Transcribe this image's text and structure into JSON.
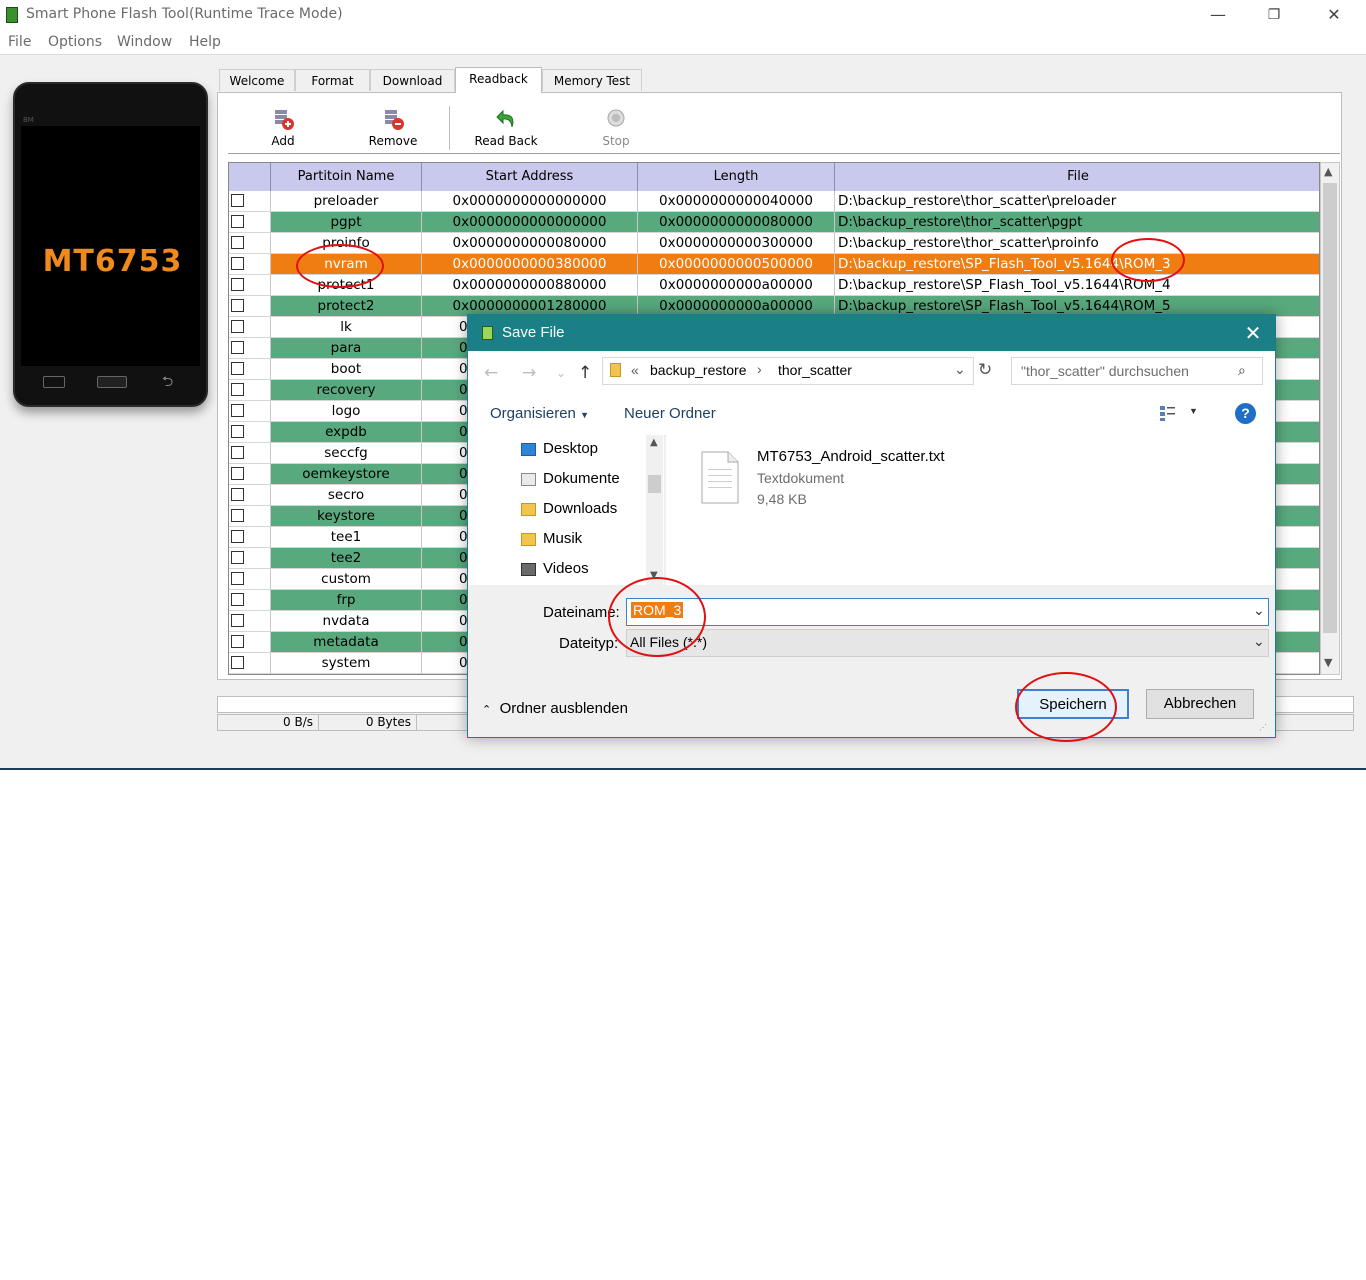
{
  "window": {
    "title": "Smart Phone Flash Tool(Runtime Trace Mode)",
    "controls": {
      "minimize": "—",
      "maximize": "❐",
      "close": "✕"
    }
  },
  "menu": [
    "File",
    "Options",
    "Window",
    "Help"
  ],
  "phone": {
    "model": "MT6753",
    "brand": "BM"
  },
  "tabs": [
    "Welcome",
    "Format",
    "Download",
    "Readback",
    "Memory Test"
  ],
  "active_tab": "Readback",
  "toolbar": {
    "add": "Add",
    "remove": "Remove",
    "read_back": "Read Back",
    "stop": "Stop"
  },
  "table": {
    "headers": [
      "Partitoin Name",
      "Start Address",
      "Length",
      "File"
    ],
    "rows": [
      {
        "name": "preloader",
        "start": "0x0000000000000000",
        "length": "0x0000000000040000",
        "file": "D:\\backup_restore\\thor_scatter\\preloader",
        "style": "white"
      },
      {
        "name": "pgpt",
        "start": "0x0000000000000000",
        "length": "0x0000000000080000",
        "file": "D:\\backup_restore\\thor_scatter\\pgpt",
        "style": "green"
      },
      {
        "name": "proinfo",
        "start": "0x0000000000080000",
        "length": "0x0000000000300000",
        "file": "D:\\backup_restore\\thor_scatter\\proinfo",
        "style": "white"
      },
      {
        "name": "nvram",
        "start": "0x0000000000380000",
        "length": "0x0000000000500000",
        "file": "D:\\backup_restore\\SP_Flash_Tool_v5.1644\\ROM_3",
        "style": "sel"
      },
      {
        "name": "protect1",
        "start": "0x0000000000880000",
        "length": "0x0000000000a00000",
        "file": "D:\\backup_restore\\SP_Flash_Tool_v5.1644\\ROM_4",
        "style": "white"
      },
      {
        "name": "protect2",
        "start": "0x0000000001280000",
        "length": "0x0000000000a00000",
        "file": "D:\\backup_restore\\SP_Flash_Tool_v5.1644\\ROM_5",
        "style": "green"
      },
      {
        "name": "lk",
        "start": "0",
        "length": "",
        "file": "",
        "style": "white"
      },
      {
        "name": "para",
        "start": "0",
        "length": "",
        "file": "",
        "style": "green"
      },
      {
        "name": "boot",
        "start": "0:",
        "length": "",
        "file": "",
        "style": "white"
      },
      {
        "name": "recovery",
        "start": "0:",
        "length": "",
        "file": "",
        "style": "green"
      },
      {
        "name": "logo",
        "start": "0:",
        "length": "",
        "file": "",
        "style": "white"
      },
      {
        "name": "expdb",
        "start": "0",
        "length": "",
        "file": "",
        "style": "green"
      },
      {
        "name": "seccfg",
        "start": "0",
        "length": "",
        "file": "",
        "style": "white"
      },
      {
        "name": "oemkeystore",
        "start": "0",
        "length": "",
        "file": "",
        "style": "green"
      },
      {
        "name": "secro",
        "start": "0:",
        "length": "",
        "file": "",
        "style": "white"
      },
      {
        "name": "keystore",
        "start": "0",
        "length": "",
        "file": "",
        "style": "green"
      },
      {
        "name": "tee1",
        "start": "0",
        "length": "",
        "file": "",
        "style": "white"
      },
      {
        "name": "tee2",
        "start": "0",
        "length": "",
        "file": "",
        "style": "green"
      },
      {
        "name": "custom",
        "start": "0:",
        "length": "",
        "file": "",
        "style": "white"
      },
      {
        "name": "frp",
        "start": "0",
        "length": "",
        "file": "",
        "style": "green"
      },
      {
        "name": "nvdata",
        "start": "0",
        "length": "",
        "file": "",
        "style": "white"
      },
      {
        "name": "metadata",
        "start": "0:",
        "length": "",
        "file": "",
        "style": "green"
      },
      {
        "name": "system",
        "start": "0:",
        "length": "",
        "file": "",
        "style": "white"
      }
    ]
  },
  "status": {
    "speed": "0 B/s",
    "bytes": "0 Bytes"
  },
  "dialog": {
    "title": "Save File",
    "close": "✕",
    "breadcrumb": {
      "sep": "«",
      "crumbs": [
        "backup_restore",
        "thor_scatter"
      ]
    },
    "search_placeholder": "\"thor_scatter\" durchsuchen",
    "organize": "Organisieren",
    "new_folder": "Neuer Ordner",
    "nav_items": [
      "Desktop",
      "Dokumente",
      "Downloads",
      "Musik",
      "Videos"
    ],
    "file": {
      "name": "MT6753_Android_scatter.txt",
      "type": "Textdokument",
      "size": "9,48 KB"
    },
    "filename_label": "Dateiname:",
    "filename_value": "ROM_3",
    "filetype_label": "Dateityp:",
    "filetype_value": "All Files (*.*)",
    "hide_folders": "Ordner ausblenden",
    "save": "Speichern",
    "cancel": "Abbrechen"
  },
  "colors": {
    "row_green": "#58a97e",
    "row_selected": "#f07d12",
    "header": "#c9c9ee",
    "dialog_title": "#1a7f86",
    "annotation": "#e01010"
  }
}
